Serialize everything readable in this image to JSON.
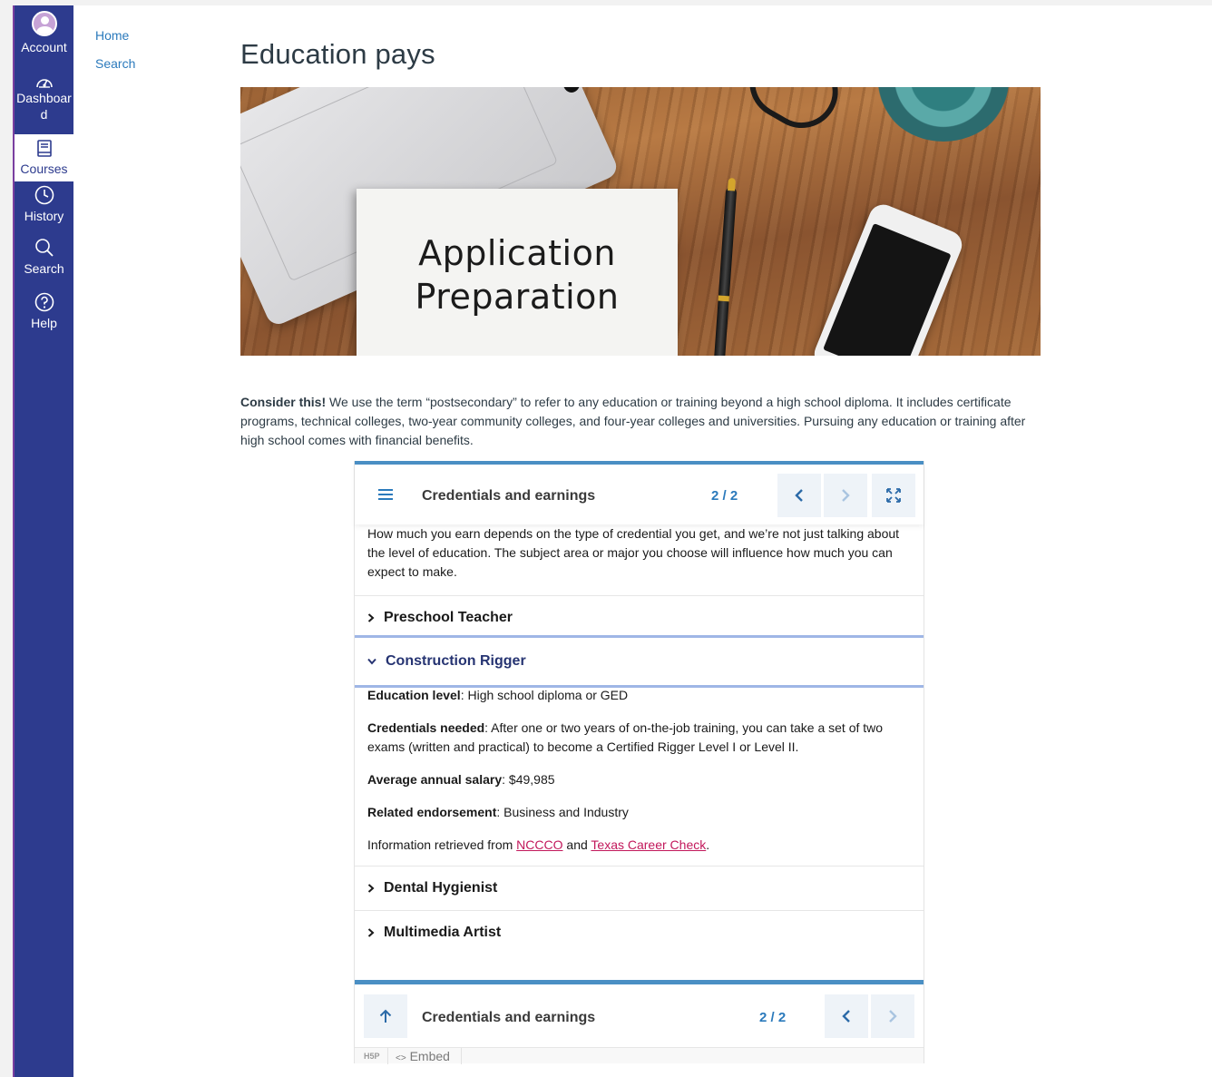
{
  "global_nav": {
    "account": "Account",
    "dashboard": "Dashboar d",
    "dashboard_line1": "Dashboar",
    "dashboard_line2": "d",
    "courses": "Courses",
    "history": "History",
    "search": "Search",
    "help": "Help",
    "brand_color": "#2d3b8e"
  },
  "course_nav": {
    "items": [
      {
        "label": "Home"
      },
      {
        "label": "Search"
      }
    ]
  },
  "page": {
    "title": "Education pays",
    "hero_card_line1": "Application",
    "hero_card_line2": "Preparation",
    "consider_bold": "Consider this!",
    "consider_text": " We use the term “postsecondary” to refer to any education or training beyond a high school diploma. It includes certificate programs, technical colleges, two-year community colleges, and four-year colleges and universities. Pursuing any education or training after high school comes with financial benefits."
  },
  "h5p": {
    "header_title": "Credentials and earnings",
    "counter": "2 / 2",
    "intro": "How much you earn depends on the type of credential you get, and we’re not just talking about the level of education. The subject area or major you choose will influence how much you can expect to make.",
    "accordion": [
      {
        "label": "Preschool Teacher",
        "expanded": false
      },
      {
        "label": "Construction Rigger",
        "expanded": true
      },
      {
        "label": "Dental Hygienist",
        "expanded": false
      },
      {
        "label": "Multimedia Artist",
        "expanded": false
      }
    ],
    "panel": {
      "education_label": "Education level",
      "education_value": ": High school diploma or GED",
      "credentials_label": "Credentials needed",
      "credentials_value": ":  After one or two years of on-the-job training, you can take a set of two exams (written and practical) to become a Certified Rigger Level I or Level II.",
      "salary_label": "Average annual salary",
      "salary_value": ": $49,985",
      "endorsement_label": "Related endorsement",
      "endorsement_value": ": Business and Industry",
      "info_prefix": "Information retrieved from ",
      "link1": "NCCCO",
      "info_and": " and ",
      "link2": "Texas Career Check",
      "info_suffix": "."
    },
    "footer_title": "Credentials and earnings",
    "footer_counter": "2 / 2",
    "h5p_logo": "H5P",
    "embed": "Embed",
    "accent_color": "#4a8fc4",
    "link_color": "#c2185b"
  }
}
